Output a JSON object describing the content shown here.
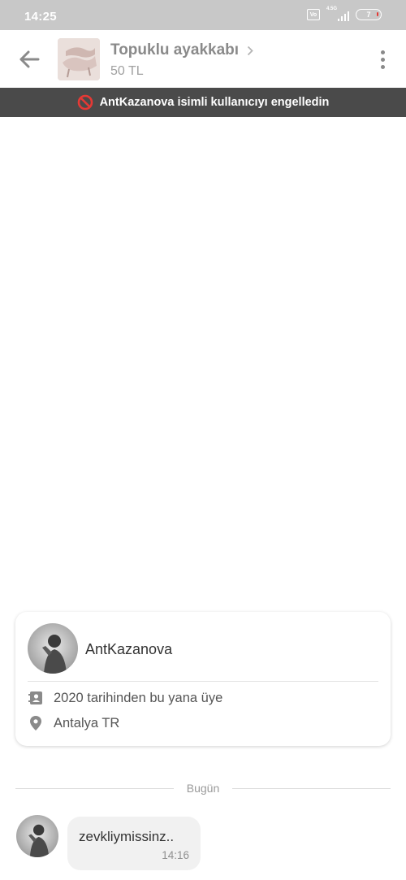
{
  "status_bar": {
    "time": "14:25",
    "vo_label": "Vo",
    "network_label": "4.5G",
    "battery_level": "7"
  },
  "app_bar": {
    "title": "Topuklu ayakkabı",
    "price": "50 TL"
  },
  "block_banner": {
    "text": "AntKazanova isimli kullanıcıyı engelledin"
  },
  "profile_card": {
    "username": "AntKazanova",
    "member_since": "2020 tarihinden bu yana üye",
    "location": "Antalya TR"
  },
  "day_separator": {
    "label": "Bugün"
  },
  "messages": [
    {
      "text": "zevkliymissinz..",
      "time": "14:16"
    }
  ],
  "colors": {
    "banner_bg": "#4a4a4a",
    "block_icon": "#e53935",
    "status_bar_bg": "#c8c8c8"
  }
}
